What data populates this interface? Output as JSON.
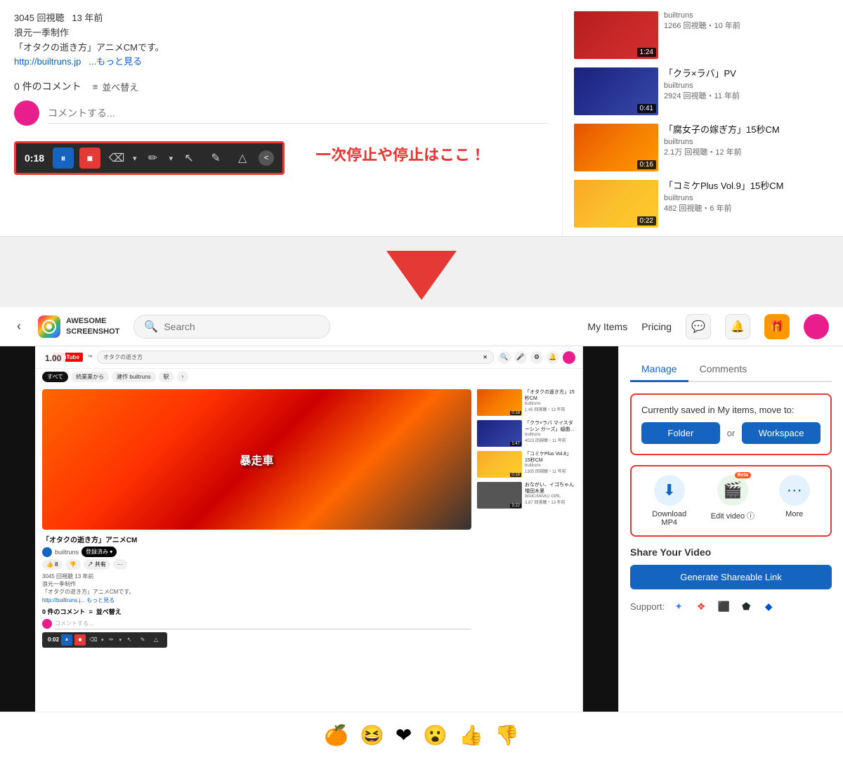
{
  "top": {
    "video_meta": {
      "views": "3045 回視聴",
      "years_ago": "13 年前",
      "creator": "浪元一季制作",
      "description": "「オタクの逝き方」アニメCMです。",
      "link_text": "http://builtruns.jp",
      "more": "...もっと見る"
    },
    "comments": {
      "count": "0 件のコメント",
      "sort": "並べ替え",
      "placeholder": "コメントする..."
    },
    "toolbar": {
      "time": "0:18",
      "annotation_text": "一次停止や停止はここ！"
    },
    "thumbnails": [
      {
        "title": "「クラ×ラバ」PV",
        "channel": "builtruns",
        "views": "2924 回視聴・11 年前",
        "duration": "0:41",
        "color": "thumb-blue"
      },
      {
        "title": "「腐女子の嫁ぎ方」15秒CM",
        "channel": "builtruns",
        "views": "2.1万 回視聴・12 年前",
        "duration": "0:16",
        "color": "thumb-orange"
      },
      {
        "title": "「コミケPlus Vol.9」15秒CM",
        "channel": "builtruns",
        "views": "482 回視聴・6 年前",
        "duration": "0:22",
        "color": "thumb-yellow"
      }
    ]
  },
  "navbar": {
    "logo_line1": "AWESOME",
    "logo_line2": "SCREENSHOT",
    "search_placeholder": "Search",
    "my_items": "My Items",
    "pricing": "Pricing"
  },
  "right_panel": {
    "tabs": [
      "Manage",
      "Comments"
    ],
    "active_tab": "Manage",
    "manage": {
      "saved_text": "Currently saved in My items, move to:",
      "folder_btn": "Folder",
      "or_text": "or",
      "workspace_btn": "Workspace",
      "download_label": "Download\nMP4",
      "edit_label": "Edit video ⓘ",
      "more_label": "More",
      "beta_label": "Beta"
    },
    "share": {
      "title": "Share Your Video",
      "btn_label": "Generate Shareable Link",
      "support_label": "Support:"
    }
  },
  "emoji_bar": {
    "emojis": [
      "🍊",
      "😆",
      "❤",
      "😮",
      "👍",
      "👎"
    ]
  },
  "youtube_mini": {
    "search_text": "オタクの逝き方",
    "video_title": "「オタクの逝き方」アニメCM",
    "channel": "builtruns",
    "views": "3045 回視聴 13 年前",
    "desc_line1": "浪元一季制作",
    "desc_line2": "「オタクの逝き方」アニメCMです。",
    "link": "http://builtruns.j...",
    "more": "もっと見る",
    "comments_count": "0 件のコメント",
    "sort": "並べ替え",
    "comment_placeholder": "コメントする...",
    "toolbar_time": "0:02",
    "tabs": [
      "すべて",
      "続業業から",
      "建作 builtruns",
      "駅"
    ],
    "sidebar_thumbs": [
      {
        "title": "「オタクの逝き方」15秒CM",
        "channel": "builtruns",
        "views": "1.45 回視聴・13 年前",
        "duration": "0:18",
        "color": "thumb-orange"
      },
      {
        "title": "「クラ×ラバ マイスターシン ガーズ」組曲Crescendo of LOVE...",
        "channel": "builtruns",
        "views": "4023 回視聴・11 年前",
        "duration": "1:47",
        "color": "thumb-blue"
      },
      {
        "title": "「コミケPlus Vol.8」15秒CM",
        "channel": "builtruns",
        "views": "1305 回視聴・11 年前",
        "duration": "0:18",
        "color": "thumb-yellow"
      },
      {
        "title": "おながい、イゴちゃん　増田木里",
        "channel": "WAKUWAKU GIRL",
        "views": "3.87 回視聴・13 年前",
        "duration": "3:22",
        "color": "thumb-purple"
      }
    ]
  }
}
